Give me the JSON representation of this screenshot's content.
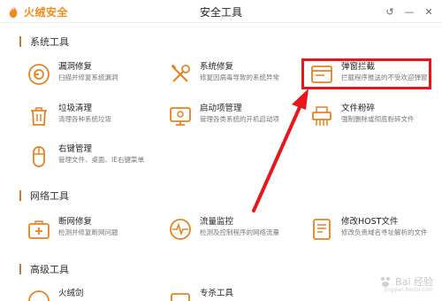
{
  "app": {
    "logo_text": "火绒安全",
    "window_title": "安全工具"
  },
  "window_controls": {
    "back": "↺",
    "minimize": "—",
    "close": "✕"
  },
  "sections": {
    "system": "系统工具",
    "network": "网络工具",
    "advanced": "高级工具"
  },
  "tools": {
    "vuln_repair": {
      "name": "漏洞修复",
      "desc": "扫描并修复系统漏洞"
    },
    "sys_repair": {
      "name": "系统修复",
      "desc": "修复因病毒导致的系统异常"
    },
    "popup_block": {
      "name": "弹窗拦截",
      "desc": "拦截程序推送的不受欢迎弹窗"
    },
    "junk_clean": {
      "name": "垃圾清理",
      "desc": "清理各种系统垃圾"
    },
    "startup_mgr": {
      "name": "启动项管理",
      "desc": "管理各类系统的开机启动项"
    },
    "file_shred": {
      "name": "文件粉碎",
      "desc": "强制删除或彻底粉碎文件"
    },
    "context_menu": {
      "name": "右键管理",
      "desc": "管理文件、桌面、IE右键菜单"
    },
    "net_repair": {
      "name": "断网修复",
      "desc": "检测并修复断网问题"
    },
    "traffic_mon": {
      "name": "流量监控",
      "desc": "检测及控制程序的网络流量"
    },
    "host_edit": {
      "name": "修改HOST文件",
      "desc": "修改负责域名寻址解析的文件"
    },
    "adv_1": {
      "name": "火绒剑",
      "desc": ""
    },
    "adv_2": {
      "name": "专杀工具",
      "desc": ""
    }
  },
  "watermark": {
    "text": "Bai 经验",
    "url": "jingyan.baidu.com"
  },
  "colors": {
    "accent": "#f28a1a",
    "icon": "#e8821f",
    "highlight": "#e8151b",
    "section_bar": "#cc7b2e"
  }
}
